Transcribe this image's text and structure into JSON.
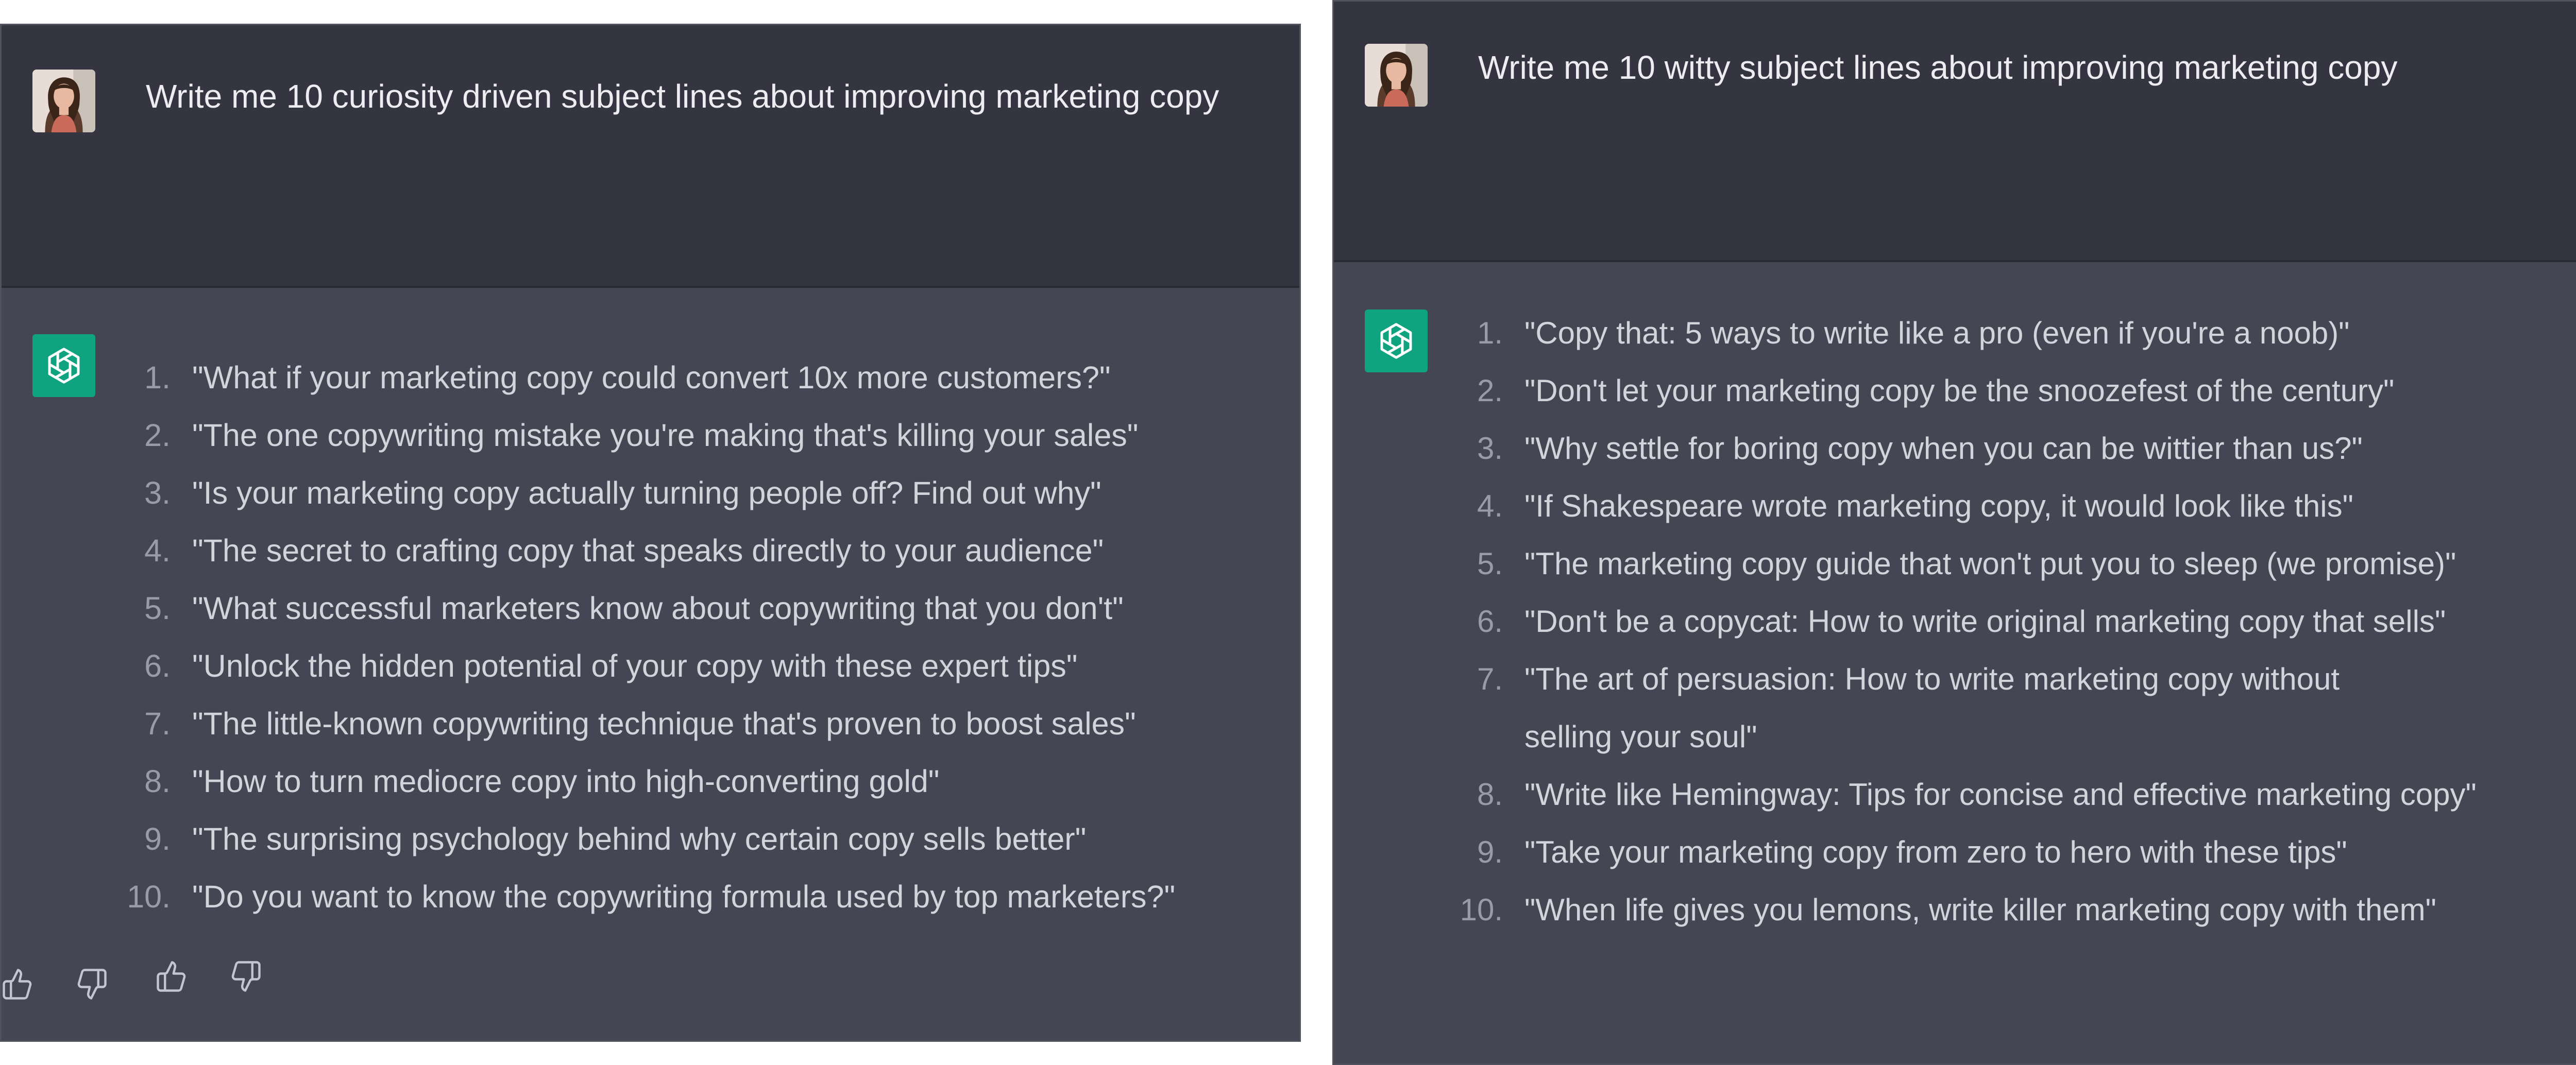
{
  "conversations": [
    {
      "prompt": "Write me 10 curiosity driven subject lines about improving marketing copy",
      "items": [
        "\"What if your marketing copy could convert 10x more customers?\"",
        "\"The one copywriting mistake you're making that's killing your sales\"",
        "\"Is your marketing copy actually turning people off? Find out why\"",
        "\"The secret to crafting copy that speaks directly to your audience\"",
        "\"What successful marketers know about copywriting that you don't\"",
        "\"Unlock the hidden potential of your copy with these expert tips\"",
        "\"The little-known copywriting technique that's proven to boost sales\"",
        "\"How to turn mediocre copy into high-converting gold\"",
        "\"The surprising psychology behind why certain copy sells better\"",
        "\"Do you want to know the copywriting formula used by top marketers?\""
      ]
    },
    {
      "prompt": "Write me 10 witty subject lines about improving marketing copy",
      "items": [
        "\"Copy that: 5 ways to write like a pro (even if you're a noob)\"",
        "\"Don't let your marketing copy be the snoozefest of the century\"",
        "\"Why settle for boring copy when you can be wittier than us?\"",
        "\"If Shakespeare wrote marketing copy, it would look like this\"",
        "\"The marketing copy guide that won't put you to sleep (we promise)\"",
        "\"Don't be a copycat: How to write original marketing copy that sells\"",
        "\"The art of persuasion: How to write marketing copy without selling your soul\"",
        "\"Write like Hemingway: Tips for concise and effective marketing copy\"",
        "\"Take your marketing copy from zero to hero with these tips\"",
        "\"When life gives you lemons, write killer marketing copy with them\""
      ]
    }
  ],
  "numbers": [
    "1.",
    "2.",
    "3.",
    "4.",
    "5.",
    "6.",
    "7.",
    "8.",
    "9.",
    "10."
  ],
  "icons": {
    "user_avatar": "user-avatar-photo",
    "bot_logo": "openai-logo-icon",
    "thumbs_up": "thumbs-up-icon",
    "thumbs_down": "thumbs-down-icon"
  },
  "colors": {
    "user_bg": "#343541",
    "assistant_bg": "#444654",
    "bot_logo_bg": "#10a37f",
    "prompt_text": "#ececf1",
    "response_text": "#d1d5db"
  }
}
